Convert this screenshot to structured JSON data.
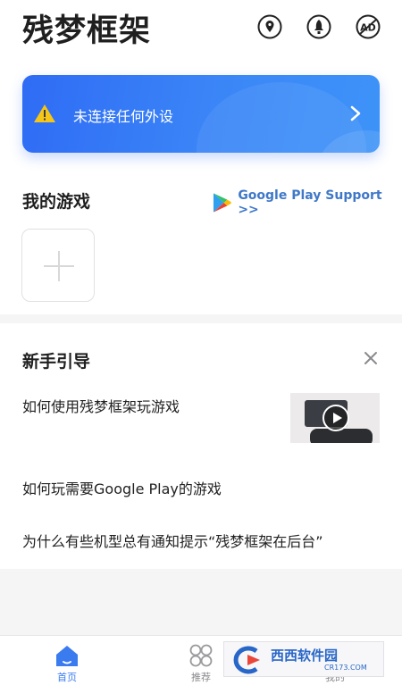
{
  "header": {
    "title": "残梦框架",
    "icons": [
      "location-pin-icon",
      "rocket-icon",
      "ad-block-icon"
    ]
  },
  "banner": {
    "text": "未连接任何外设",
    "icon": "warning-icon",
    "accent": "#2f6cf5"
  },
  "my_games": {
    "title": "我的游戏",
    "google_play_link": "Google Play Support >>",
    "add_icon": "plus-icon"
  },
  "guide": {
    "title": "新手引导",
    "items": [
      {
        "label": "如何使用残梦框架玩游戏"
      },
      {
        "label": "如何玩需要Google Play的游戏"
      },
      {
        "label": "为什么有些机型总有通知提示“残梦框架在后台”"
      }
    ]
  },
  "bottom_nav": {
    "items": [
      {
        "label": "首页",
        "icon": "home-icon",
        "active": true
      },
      {
        "label": "推荐",
        "icon": "grid-icon",
        "active": false
      },
      {
        "label": "我的",
        "icon": "user-icon",
        "active": false
      }
    ]
  },
  "watermark": {
    "text": "西西软件园",
    "sub": "CR173.COM"
  },
  "colors": {
    "accent": "#3a7bf0",
    "link": "#3f78c8",
    "banner_start": "#2f6cf5",
    "banner_end": "#3d93f8"
  }
}
